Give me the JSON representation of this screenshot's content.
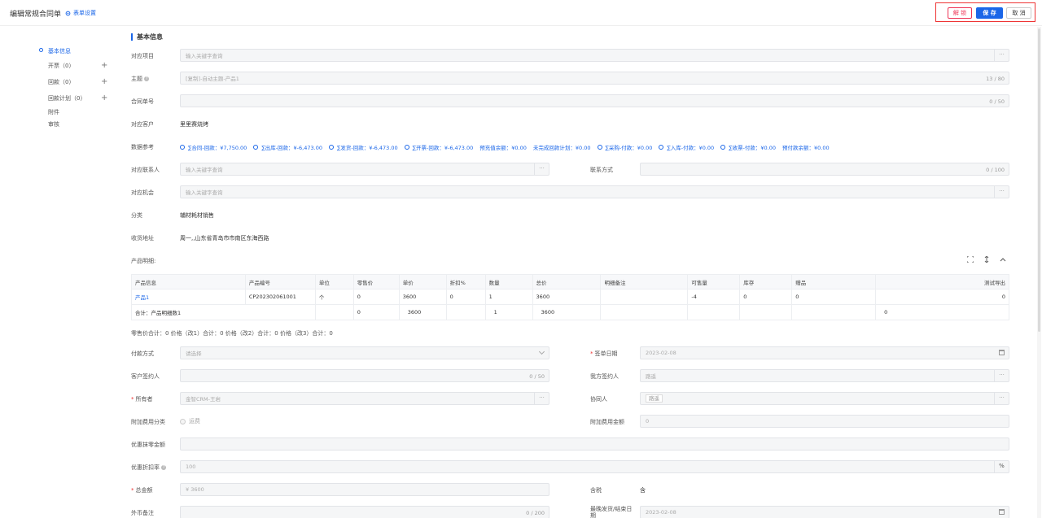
{
  "header": {
    "title": "编辑常规合同单",
    "form_settings": "表单设置",
    "unlock": "解 锁",
    "save": "保 存",
    "cancel": "取 消"
  },
  "nav": {
    "basic": "基本信息",
    "invoice": "开票（0）",
    "payment": "回款（0）",
    "plan": "回款计划（0）",
    "attachment": "附件",
    "audit": "审核"
  },
  "section_title": "基本信息",
  "fields": {
    "project_label": "对应项目",
    "project_placeholder": "输入关键字查询",
    "subject_label": "主题",
    "subject_value": "[复制]-自动主题-产品1",
    "subject_count": "13 / 80",
    "contract_no_label": "合同单号",
    "contract_no_count": "0 / 50",
    "customer_label": "对应客户",
    "customer_value": "里里赛烧烤",
    "ref_label": "数据参考",
    "contact_label": "对应联系人",
    "contact_placeholder": "输入关键字查询",
    "contact_way_label": "联系方式",
    "contact_way_count": "0 / 100",
    "opportunity_label": "对应机会",
    "opportunity_placeholder": "输入关键字查询",
    "category_label": "分类",
    "category_value": "辅材耗材销售",
    "address_label": "收货地址",
    "address_value": "周一,,山东省青岛市市南区东海西路",
    "products_label": "产品明细:",
    "price_summary": "零售价合计：0 价格（改1）合计：0 价格（改2）合计：0 价格（改3）合计：0",
    "pay_method_label": "付款方式",
    "pay_method_placeholder": "请选择",
    "sign_date_label": "签单日期",
    "sign_date_value": "2023-02-08",
    "cust_signer_label": "客户签约人",
    "cust_signer_count": "0 / 50",
    "our_signer_label": "我方签约人",
    "our_signer_value": "路遥",
    "owner_label": "所有者",
    "owner_value": "金智CRM-王岩",
    "collab_label": "协同人",
    "collab_tag": "路遥",
    "extra_cat_label": "附加费用分类",
    "extra_cat_option": "运费",
    "extra_amount_label": "附加费用金额",
    "extra_amount_value": "0",
    "discount_amount_label": "优惠抹零金额",
    "discount_rate_label": "优惠折扣率",
    "discount_rate_value": "100",
    "discount_rate_unit": "%",
    "total_label": "总金额",
    "total_value": "¥  3600",
    "tax_label": "含税",
    "tax_value": "含",
    "fx_note_label": "外币备注",
    "fx_note_count": "0 / 200",
    "latest_date_label": "最晚发货/结束日期",
    "latest_date_value": "2023-02-08"
  },
  "refs": [
    {
      "text": "∑合同-回款：¥7,750.00",
      "icon": true
    },
    {
      "text": "∑出库-回款：¥-6,473.00",
      "icon": true
    },
    {
      "text": "∑发货-回款：¥-6,473.00",
      "icon": true
    },
    {
      "text": "∑开票-回款：¥-6,473.00",
      "icon": true
    },
    {
      "text": "预充值余额：¥0.00",
      "icon": false
    },
    {
      "text": "未完成回款计划：¥0.00",
      "icon": false
    },
    {
      "text": "∑采购-付款：¥0.00",
      "icon": true
    },
    {
      "text": "∑入库-付款：¥0.00",
      "icon": true
    },
    {
      "text": "∑收票-付款：¥0.00",
      "icon": true
    },
    {
      "text": "预付款余额：¥0.00",
      "icon": false
    }
  ],
  "table": {
    "headers": [
      "产品信息",
      "产品编号",
      "单位",
      "零售价",
      "单价",
      "折扣%",
      "数量",
      "总价",
      "明细备注",
      "可售量",
      "库存",
      "赠品",
      "测试导出"
    ],
    "row": [
      "产品1",
      "CP202302061001",
      "个",
      "0",
      "3600",
      "0",
      "1",
      "3600",
      "",
      "-4",
      "0",
      "0",
      "0"
    ],
    "total_row": [
      "合计：产品明细数1",
      "0",
      "3600",
      "1",
      "3600",
      "0"
    ]
  }
}
